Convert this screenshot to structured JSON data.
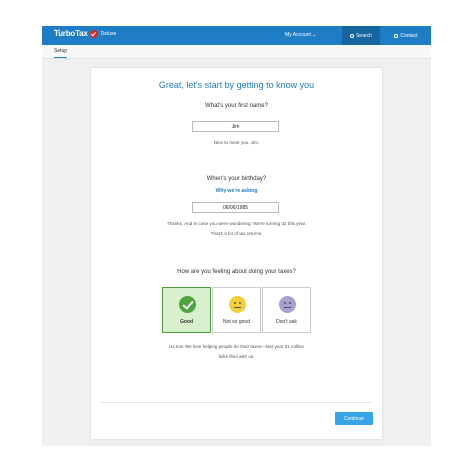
{
  "header": {
    "logo_small": "intuit",
    "logo_text": "TurboTax",
    "edition": "Deluxe",
    "account_label": "My Account",
    "search_label": "Search",
    "contact_label": "Contact"
  },
  "subnav": {
    "tab_label": "Setup"
  },
  "main": {
    "title": "Great, let's start by getting to know you",
    "name_question": "What's your first name?",
    "name_value": "Jim",
    "name_message": "Nice to meet you, Jim.",
    "birthday_question": "When's your birthday?",
    "birthday_link": "Why we're asking",
    "birthday_value": "06/06/1985",
    "birthday_message_line1": "Thanks. And in case you were wondering: We're turning 32 this year.",
    "birthday_message_line2": "That's a lot of tax returns.",
    "feeling_question": "How are you feeling about doing your taxes?",
    "moods": [
      {
        "label": "Good",
        "selected": true
      },
      {
        "label": "Not so good",
        "selected": false
      },
      {
        "label": "Don't ask",
        "selected": false
      }
    ],
    "mood_message_line1": "Us too! We love helping people do their taxes—last year 31 million",
    "mood_message_line2": "folks filed with us.",
    "continue_label": "Continue"
  },
  "colors": {
    "brand_blue": "#1f7dc6",
    "selected_green": "#4fa33d",
    "continue_blue": "#36a4e6"
  }
}
